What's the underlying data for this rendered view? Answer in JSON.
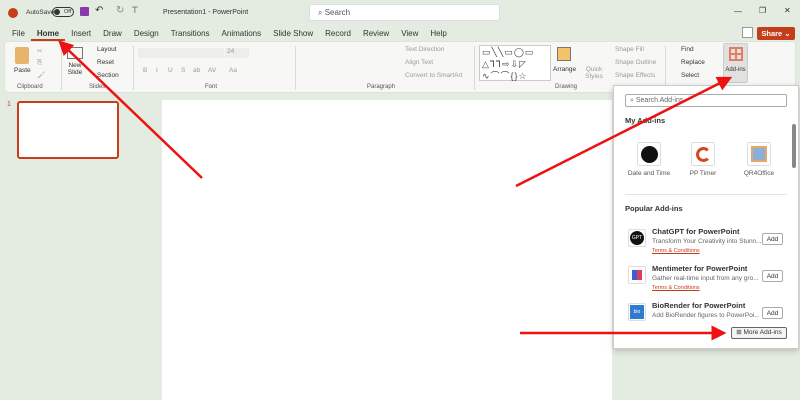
{
  "titlebar": {
    "autosave": "AutoSave",
    "toggle": "Off",
    "title": "Presentation1  -  PowerPoint",
    "search": "Search",
    "minimize": "—",
    "restore": "❐",
    "close": "✕"
  },
  "tabs": [
    "File",
    "Home",
    "Insert",
    "Draw",
    "Design",
    "Transitions",
    "Animations",
    "Slide Show",
    "Record",
    "Review",
    "View",
    "Help"
  ],
  "share": "Share",
  "ribbon": {
    "paste": "Paste",
    "clipboard": "Clipboard",
    "new_slide": "New Slide",
    "layout": "Layout",
    "reset": "Reset",
    "section": "Section",
    "slides": "Slides",
    "font_size": "24",
    "font": "Font",
    "text_direction": "Text Direction",
    "align_text": "Align Text",
    "convert_smartart": "Convert to SmartArt",
    "paragraph": "Paragraph",
    "arrange": "Arrange",
    "quick_styles": "Quick Styles",
    "shape_fill": "Shape Fill",
    "shape_outline": "Shape Outline",
    "shape_effects": "Shape Effects",
    "drawing": "Drawing",
    "find": "Find",
    "replace": "Replace",
    "select": "Select",
    "addins": "Add-ins",
    "fmt": [
      "B",
      "I",
      "U",
      "S",
      "ab",
      "AV",
      "Aa"
    ]
  },
  "thumbnail_number": "1",
  "panel": {
    "search_placeholder": "Search Add-ins",
    "my_addins": "My Add-ins",
    "my": [
      {
        "name": "Date and Time"
      },
      {
        "name": "PP Timer"
      },
      {
        "name": "QR4Office"
      }
    ],
    "popular": "Popular Add-ins",
    "items": [
      {
        "title": "ChatGPT for PowerPoint",
        "desc": "Transform Your Creativity into Stunn...",
        "link": "Terms & Conditions",
        "add": "Add",
        "icon_text": "GPT"
      },
      {
        "title": "Mentimeter for PowerPoint",
        "desc": "Gather real-time input from any gro...",
        "link": "Terms & Conditions",
        "add": "Add",
        "icon_text": ""
      },
      {
        "title": "BioRender for PowerPoint",
        "desc": "Add BioRender figures to PowerPoi...",
        "link": "",
        "add": "Add",
        "icon_text": "bio"
      }
    ],
    "more": "More Add-ins"
  },
  "colors": {
    "accent": "#c43e1c",
    "arrow": "#ee1111"
  }
}
